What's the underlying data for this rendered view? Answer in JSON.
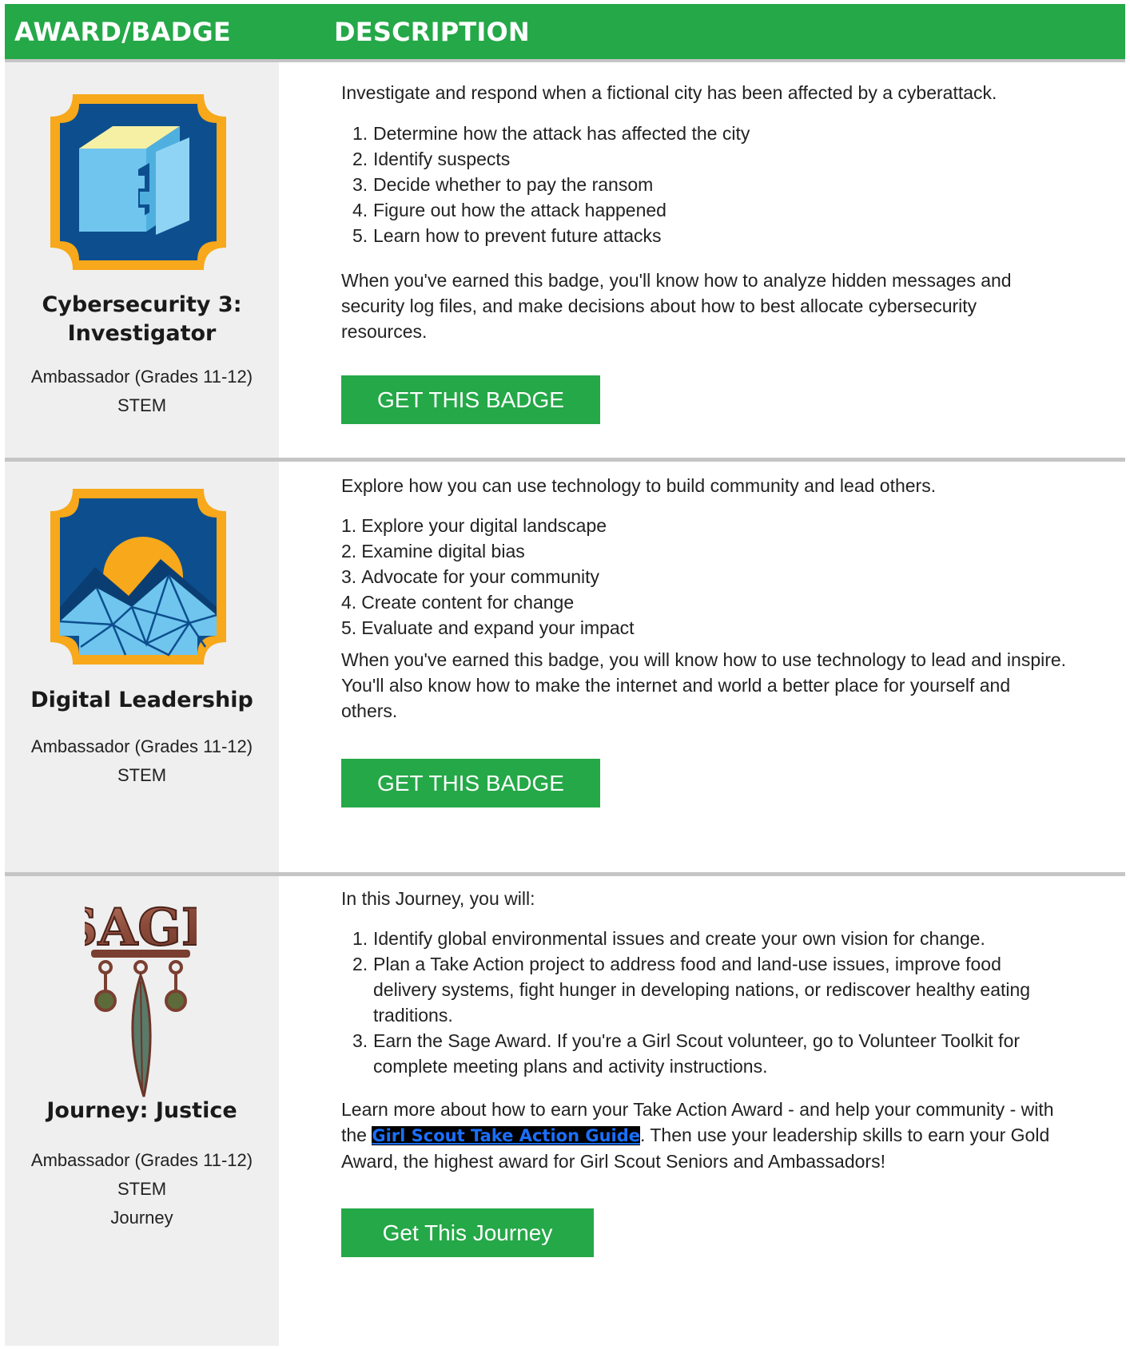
{
  "header": {
    "col1": "AWARD/BADGE",
    "col2": "DESCRIPTION"
  },
  "rows": [
    {
      "name_line1": "Cybersecurity 3:",
      "name_line2": "Investigator",
      "level": "Ambassador (Grades 11-12)",
      "category": "STEM",
      "intro": "Investigate and respond when a fictional city has been affected by a cyberattack.",
      "steps": [
        "Determine how the attack has affected the city",
        "Identify suspects",
        "Decide whether to pay the ransom",
        "Figure out how the attack happened",
        "Learn how to prevent future attacks"
      ],
      "outro_line1": "When you've earned this badge, you'll know how to analyze hidden messages and",
      "outro_line2": "security log files, and make decisions about how to best allocate cybersecurity",
      "outro_line3": "resources.",
      "button": "GET THIS BADGE"
    },
    {
      "name_line1": "Digital Leadership",
      "level": "Ambassador (Grades 11-12)",
      "category": "STEM",
      "intro": "Explore how you can use technology to build community and lead others.",
      "steps": [
        "Explore your digital landscape",
        "Examine digital bias",
        "Advocate for your community",
        "Create content for change",
        "Evaluate and expand your impact"
      ],
      "outro_line1": "When you've earned this badge, you will know how to use technology to lead and inspire.",
      "outro_line2": "You'll also know how to make the internet and world a better place for yourself and",
      "outro_line3": "others.",
      "button": "GET THIS BADGE"
    },
    {
      "name_line1": "Journey: Justice",
      "level": "Ambassador (Grades 11-12)",
      "category": "STEM",
      "type": "Journey",
      "intro": "In this Journey, you will:",
      "steps": [
        [
          "Identify global environmental issues and create your own vision for change."
        ],
        [
          "Plan a Take Action project to address food and land-use issues, improve food",
          "delivery systems, fight hunger in developing nations, or rediscover healthy eating",
          "traditions."
        ],
        [
          "Earn the Sage Award. If you're a Girl Scout volunteer, go to Volunteer Toolkit for",
          "complete meeting plans and activity instructions."
        ]
      ],
      "outro_line1": "Learn more about how to earn your Take Action Award - and help your community - with",
      "outro_pre": "the ",
      "outro_link": "Girl Scout Take Action Guide",
      "outro_post": ". Then use your leadership skills to earn your Gold",
      "outro_line3": "Award, the highest award for Girl Scout Seniors and Ambassadors!",
      "button": "Get This Journey",
      "pin_text": "SAGE"
    }
  ],
  "colors": {
    "green": "#25a848",
    "gray": "#efefef",
    "divider": "#c5c5c5",
    "orange": "#f7a81b",
    "navy": "#0d4f8e"
  }
}
